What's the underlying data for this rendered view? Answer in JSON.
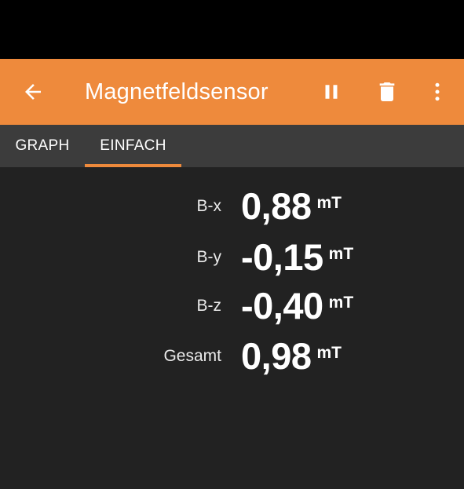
{
  "app_bar": {
    "title": "Magnetfeldsensor",
    "back_icon": "arrow-left-icon",
    "pause_icon": "pause-icon",
    "delete_icon": "trash-icon",
    "more_icon": "more-vert-icon",
    "color": "#ee8a3c"
  },
  "tabs": [
    {
      "label": "GRAPH",
      "selected": false
    },
    {
      "label": "EINFACH",
      "selected": true
    }
  ],
  "readings": [
    {
      "label": "B-x",
      "value": "0,88",
      "unit": "mT"
    },
    {
      "label": "B-y",
      "value": "-0,15",
      "unit": "mT"
    },
    {
      "label": "B-z",
      "value": "-0,40",
      "unit": "mT"
    },
    {
      "label": "Gesamt",
      "value": "0,98",
      "unit": "mT"
    }
  ]
}
